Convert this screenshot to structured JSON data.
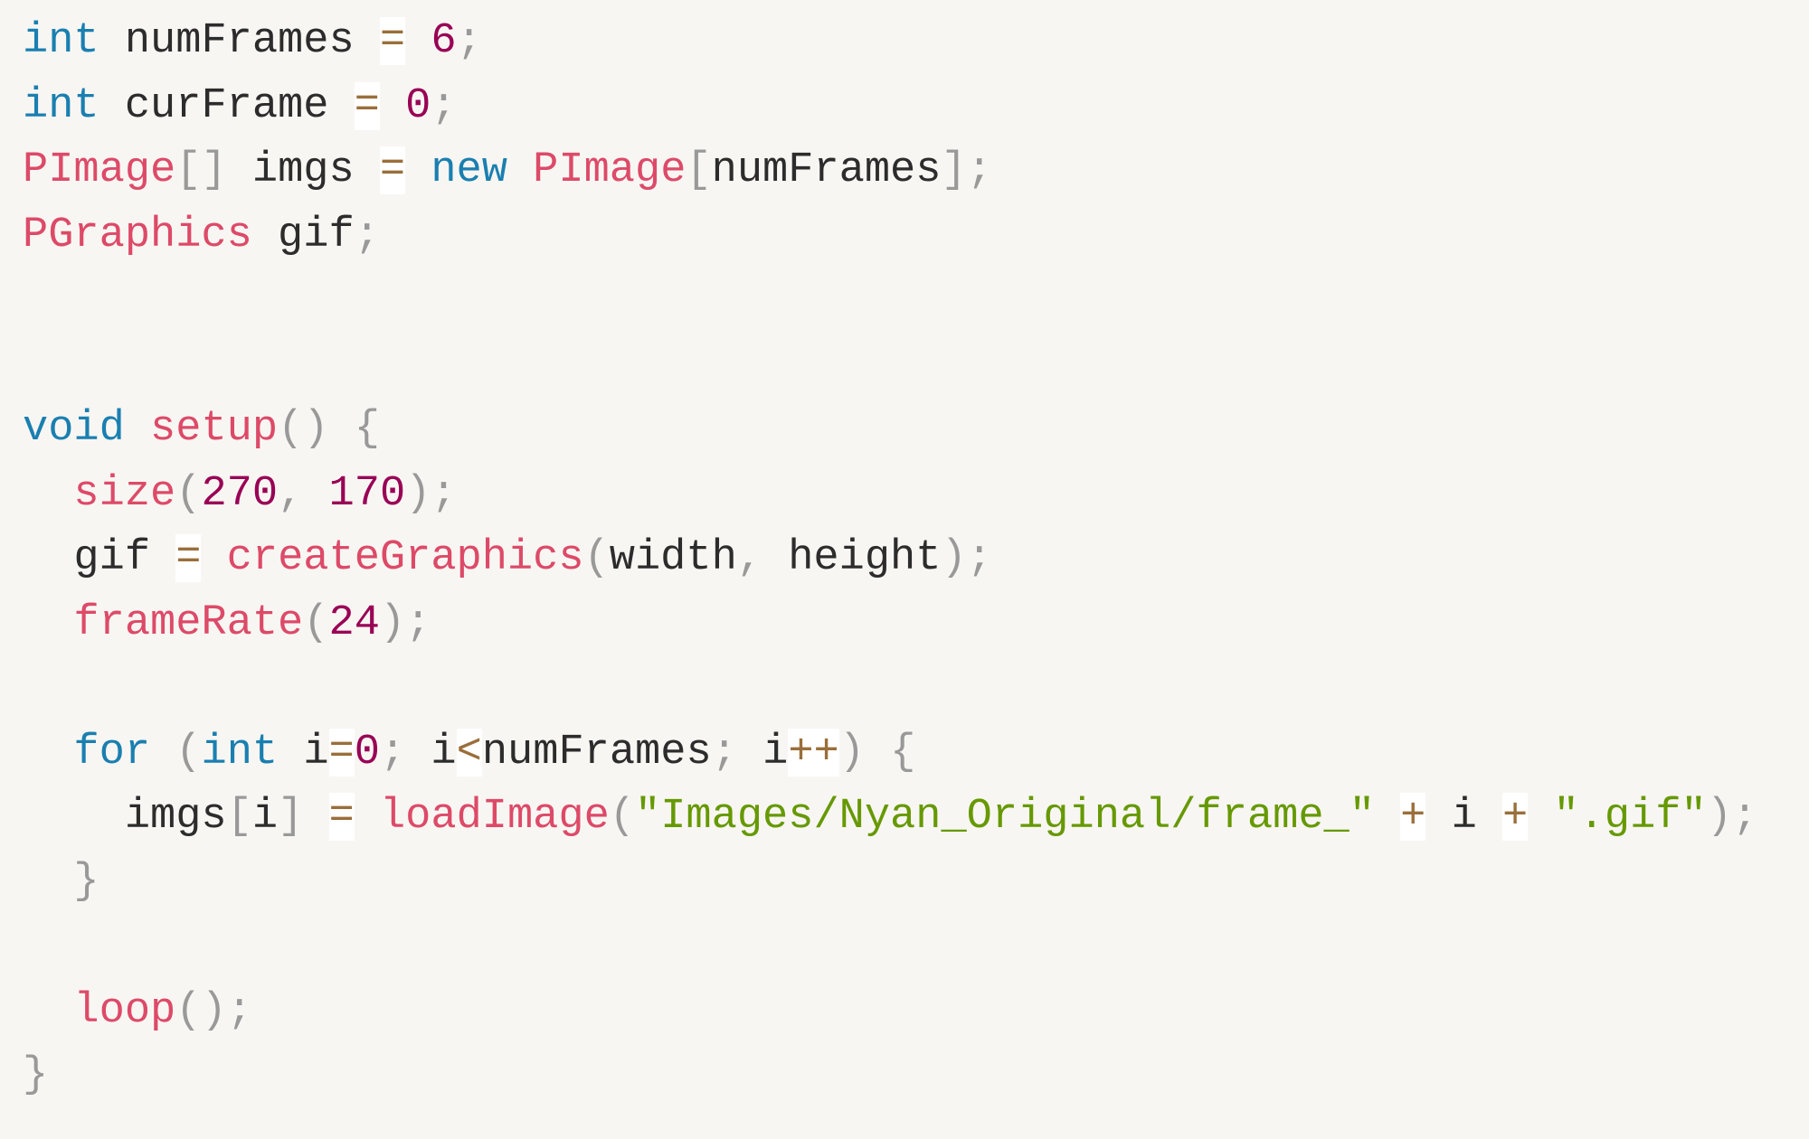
{
  "editor": {
    "language": "Processing",
    "colors": {
      "background": "#f8f6f3",
      "keyword": "#1a7fb0",
      "function": "#dd4a68",
      "number": "#990055",
      "string": "#669900",
      "operator": "#9a6e3a",
      "punctuation": "#999999",
      "identifier": "#2c2c2c"
    },
    "lines": [
      [
        [
          "kw",
          "int"
        ],
        [
          "id",
          " numFrames "
        ],
        [
          "op",
          "="
        ],
        [
          "id",
          " "
        ],
        [
          "num",
          "6"
        ],
        [
          "pn",
          ";"
        ]
      ],
      [
        [
          "kw",
          "int"
        ],
        [
          "id",
          " curFrame "
        ],
        [
          "op",
          "="
        ],
        [
          "id",
          " "
        ],
        [
          "num",
          "0"
        ],
        [
          "pn",
          ";"
        ]
      ],
      [
        [
          "fn",
          "PImage"
        ],
        [
          "pn",
          "[]"
        ],
        [
          "id",
          " imgs "
        ],
        [
          "op",
          "="
        ],
        [
          "id",
          " "
        ],
        [
          "kw",
          "new"
        ],
        [
          "id",
          " "
        ],
        [
          "fn",
          "PImage"
        ],
        [
          "pn",
          "["
        ],
        [
          "id",
          "numFrames"
        ],
        [
          "pn",
          "];"
        ]
      ],
      [
        [
          "fn",
          "PGraphics"
        ],
        [
          "id",
          " gif"
        ],
        [
          "pn",
          ";"
        ]
      ],
      [],
      [],
      [
        [
          "kw",
          "void"
        ],
        [
          "id",
          " "
        ],
        [
          "fn",
          "setup"
        ],
        [
          "pn",
          "()"
        ],
        [
          "id",
          " "
        ],
        [
          "pn",
          "{"
        ]
      ],
      [
        [
          "id",
          "  "
        ],
        [
          "fn",
          "size"
        ],
        [
          "pn",
          "("
        ],
        [
          "num",
          "270"
        ],
        [
          "pn",
          ","
        ],
        [
          "id",
          " "
        ],
        [
          "num",
          "170"
        ],
        [
          "pn",
          ");"
        ]
      ],
      [
        [
          "id",
          "  gif "
        ],
        [
          "op",
          "="
        ],
        [
          "id",
          " "
        ],
        [
          "fn",
          "createGraphics"
        ],
        [
          "pn",
          "("
        ],
        [
          "id",
          "width"
        ],
        [
          "pn",
          ","
        ],
        [
          "id",
          " height"
        ],
        [
          "pn",
          ");"
        ]
      ],
      [
        [
          "id",
          "  "
        ],
        [
          "fn",
          "frameRate"
        ],
        [
          "pn",
          "("
        ],
        [
          "num",
          "24"
        ],
        [
          "pn",
          ");"
        ]
      ],
      [],
      [
        [
          "id",
          "  "
        ],
        [
          "kw",
          "for"
        ],
        [
          "id",
          " "
        ],
        [
          "pn",
          "("
        ],
        [
          "kw",
          "int"
        ],
        [
          "id",
          " i"
        ],
        [
          "op",
          "="
        ],
        [
          "num",
          "0"
        ],
        [
          "pn",
          ";"
        ],
        [
          "id",
          " i"
        ],
        [
          "op",
          "<"
        ],
        [
          "id",
          "numFrames"
        ],
        [
          "pn",
          ";"
        ],
        [
          "id",
          " i"
        ],
        [
          "op",
          "++"
        ],
        [
          "pn",
          ")"
        ],
        [
          "id",
          " "
        ],
        [
          "pn",
          "{"
        ]
      ],
      [
        [
          "id",
          "    imgs"
        ],
        [
          "pn",
          "["
        ],
        [
          "id",
          "i"
        ],
        [
          "pn",
          "]"
        ],
        [
          "id",
          " "
        ],
        [
          "op",
          "="
        ],
        [
          "id",
          " "
        ],
        [
          "fn",
          "loadImage"
        ],
        [
          "pn",
          "("
        ],
        [
          "str",
          "\"Images/Nyan_Original/frame_\""
        ],
        [
          "id",
          " "
        ],
        [
          "op",
          "+"
        ],
        [
          "id",
          " i "
        ],
        [
          "op",
          "+"
        ],
        [
          "id",
          " "
        ],
        [
          "str",
          "\".gif\""
        ],
        [
          "pn",
          ");"
        ]
      ],
      [
        [
          "id",
          "  "
        ],
        [
          "pn",
          "}"
        ]
      ],
      [],
      [
        [
          "id",
          "  "
        ],
        [
          "fn",
          "loop"
        ],
        [
          "pn",
          "();"
        ]
      ],
      [
        [
          "pn",
          "}"
        ]
      ]
    ]
  }
}
